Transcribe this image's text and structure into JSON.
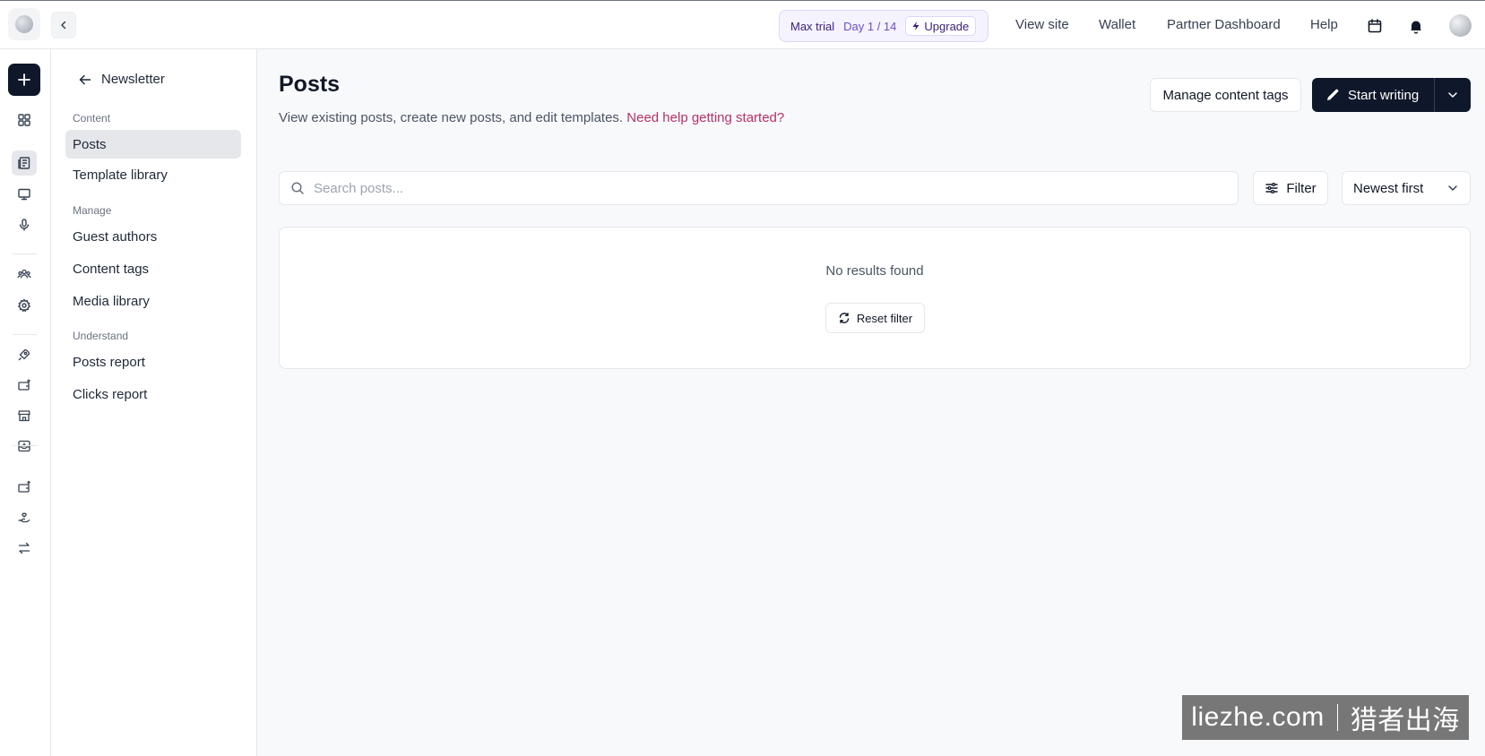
{
  "topbar": {
    "trial_label": "Max trial",
    "trial_day": "Day 1 / 14",
    "upgrade_label": "Upgrade",
    "nav": [
      "View site",
      "Wallet",
      "Partner Dashboard",
      "Help"
    ]
  },
  "sidebar": {
    "back_label": "Newsletter",
    "sections": [
      {
        "label": "Content",
        "items": [
          "Posts",
          "Template library"
        ]
      },
      {
        "label": "Manage",
        "items": [
          "Guest authors",
          "Content tags",
          "Media library"
        ]
      },
      {
        "label": "Understand",
        "items": [
          "Posts report",
          "Clicks report"
        ]
      }
    ],
    "active_item": "Posts"
  },
  "page": {
    "title": "Posts",
    "subtitle": "View existing posts, create new posts, and edit templates.",
    "help_link": "Need help getting started?",
    "manage_tags_label": "Manage content tags",
    "start_writing_label": "Start writing",
    "search_placeholder": "Search posts...",
    "filter_label": "Filter",
    "sort_value": "Newest first",
    "empty_message": "No results found",
    "reset_label": "Reset filter"
  },
  "watermark": {
    "text_left": "liezhe.com",
    "text_right": "猎者出海"
  },
  "colors": {
    "primary_dark": "#0f172a",
    "link": "#b5326b",
    "trial_accent": "#6d4fc4",
    "page_bg": "#f8f9fb"
  }
}
